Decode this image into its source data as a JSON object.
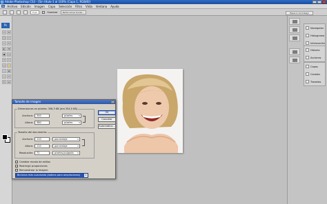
{
  "window": {
    "title": "Adobe Photoshop CS3 - [Sin título-1 al 100% (Capa 1, RGB/8)]"
  },
  "menubar": {
    "ps_label": "Ps",
    "items": [
      "Archivo",
      "Edición",
      "Imagen",
      "Capa",
      "Selección",
      "Filtro",
      "Vista",
      "Ventana",
      "Ayuda"
    ]
  },
  "options_bar": {
    "field_value": "0 px",
    "antialias_label": "Suavizar",
    "refine_label": "Perfeccionar borde...",
    "workspace_tab": "Espacio de trabajo"
  },
  "toolbox": {
    "logo": "Ps",
    "tools": [
      "▭",
      "✥",
      "◯",
      "✂",
      "⌖",
      "✎",
      "◐",
      "✚",
      "●",
      "◫",
      "T",
      "↖",
      "▢",
      "✋",
      "⌕",
      "◉",
      "⬚",
      "✦",
      "⎘",
      "◈"
    ]
  },
  "panels": {
    "group1": [
      "Navegador",
      "Histograma",
      "Información"
    ],
    "group2": [
      "Historia",
      "Acciones"
    ],
    "group3": [
      "Capas",
      "Canales",
      "Trazados"
    ]
  },
  "dialog": {
    "title": "Tamaño de imagen",
    "pixel_dims_label": "Dimensiones en píxeles: 356,3 KB (era 354,5 KB)",
    "pixel_width_label": "Anchura:",
    "pixel_width_value": "300",
    "pixel_width_unit": "píxeles",
    "pixel_height_label": "Altura:",
    "pixel_height_value": "380",
    "pixel_height_unit": "píxeles",
    "doc_size_label": "Tamaño del documento:",
    "doc_width_label": "Anchura:",
    "doc_width_value": "110",
    "doc_width_unit": "porcentaje",
    "doc_height_label": "Altura:",
    "doc_height_value": "110",
    "doc_height_unit": "porcentaje",
    "resolution_label": "Resolución:",
    "resolution_value": "72",
    "resolution_unit": "píxeles/pulgada",
    "ok_label": "OK",
    "cancel_label": "Cancelar",
    "auto_label": "Automático...",
    "scale_styles_label": "Cambiar escala de estilos",
    "constrain_label": "Restringir proporciones",
    "resample_label": "Remuestrear la imagen:",
    "resample_method": "Bicúbica más suavizada (óptima para ampliaciones)"
  }
}
